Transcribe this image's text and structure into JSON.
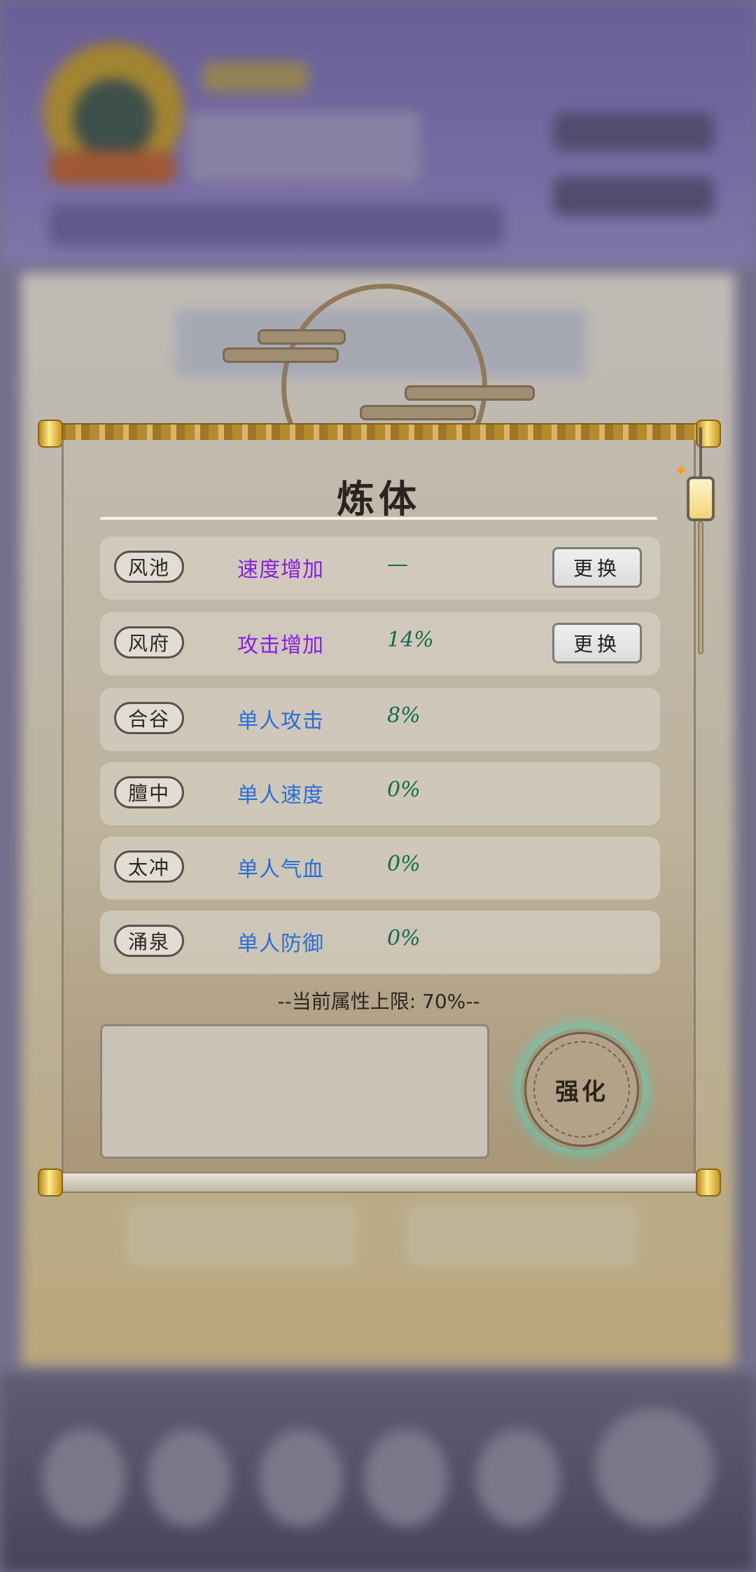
{
  "panel": {
    "title": "炼体",
    "rows": [
      {
        "acupoint": "风池",
        "attribute": "速度增加",
        "value": "—",
        "swap_label": "更换",
        "color": "#8a1fe0"
      },
      {
        "acupoint": "风府",
        "attribute": "攻击增加",
        "value": "14%",
        "swap_label": "更换",
        "color": "#8a1fe0"
      },
      {
        "acupoint": "合谷",
        "attribute": "单人攻击",
        "value": "8%",
        "color": "#2a6fd6"
      },
      {
        "acupoint": "膻中",
        "attribute": "单人速度",
        "value": "0%",
        "color": "#2a6fd6"
      },
      {
        "acupoint": "太冲",
        "attribute": "单人气血",
        "value": "0%",
        "color": "#2a6fd6"
      },
      {
        "acupoint": "涌泉",
        "attribute": "单人防御",
        "value": "0%",
        "color": "#2a6fd6"
      }
    ],
    "limit_text": "--当前属性上限: 70%--",
    "strengthen_label": "强化",
    "input_value": ""
  },
  "colors": {
    "value_text": "#136b4d",
    "button_glow": "#40e0c8"
  }
}
